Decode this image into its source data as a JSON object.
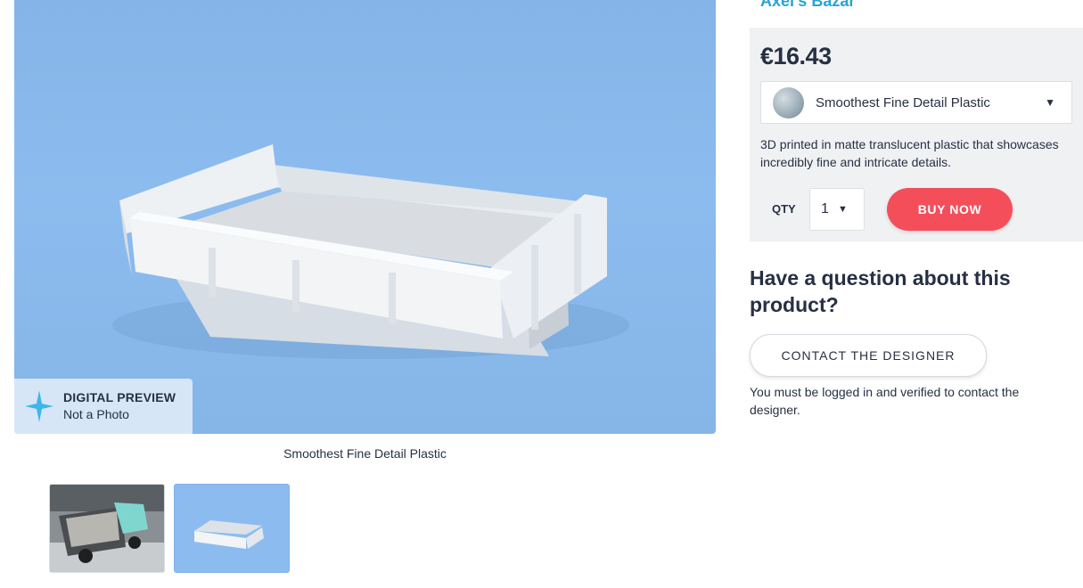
{
  "shop": {
    "name": "Axel's Bazar"
  },
  "gallery": {
    "preview_badge": {
      "title": "DIGITAL PREVIEW",
      "subtitle": "Not a Photo"
    },
    "caption": "Smoothest Fine Detail Plastic",
    "thumbnails": [
      {
        "name": "photo-dump-truck"
      },
      {
        "name": "render-truck-bed",
        "selected": true
      }
    ]
  },
  "purchase": {
    "price": "€16.43",
    "material": {
      "label": "Smoothest Fine Detail Plastic"
    },
    "description": "3D printed in matte translucent plastic that showcases incredibly fine and intricate details.",
    "qty_label": "QTY",
    "qty_value": "1",
    "buy_label": "BUY NOW",
    "colors": {
      "buy": "#f54e5b",
      "panel": "#f0f1f3",
      "shop_link": "#2aa3d6"
    }
  },
  "contact": {
    "heading": "Have a question about this product?",
    "button_label": "CONTACT THE DESIGNER",
    "note": "You must be logged in and verified to contact the designer."
  }
}
